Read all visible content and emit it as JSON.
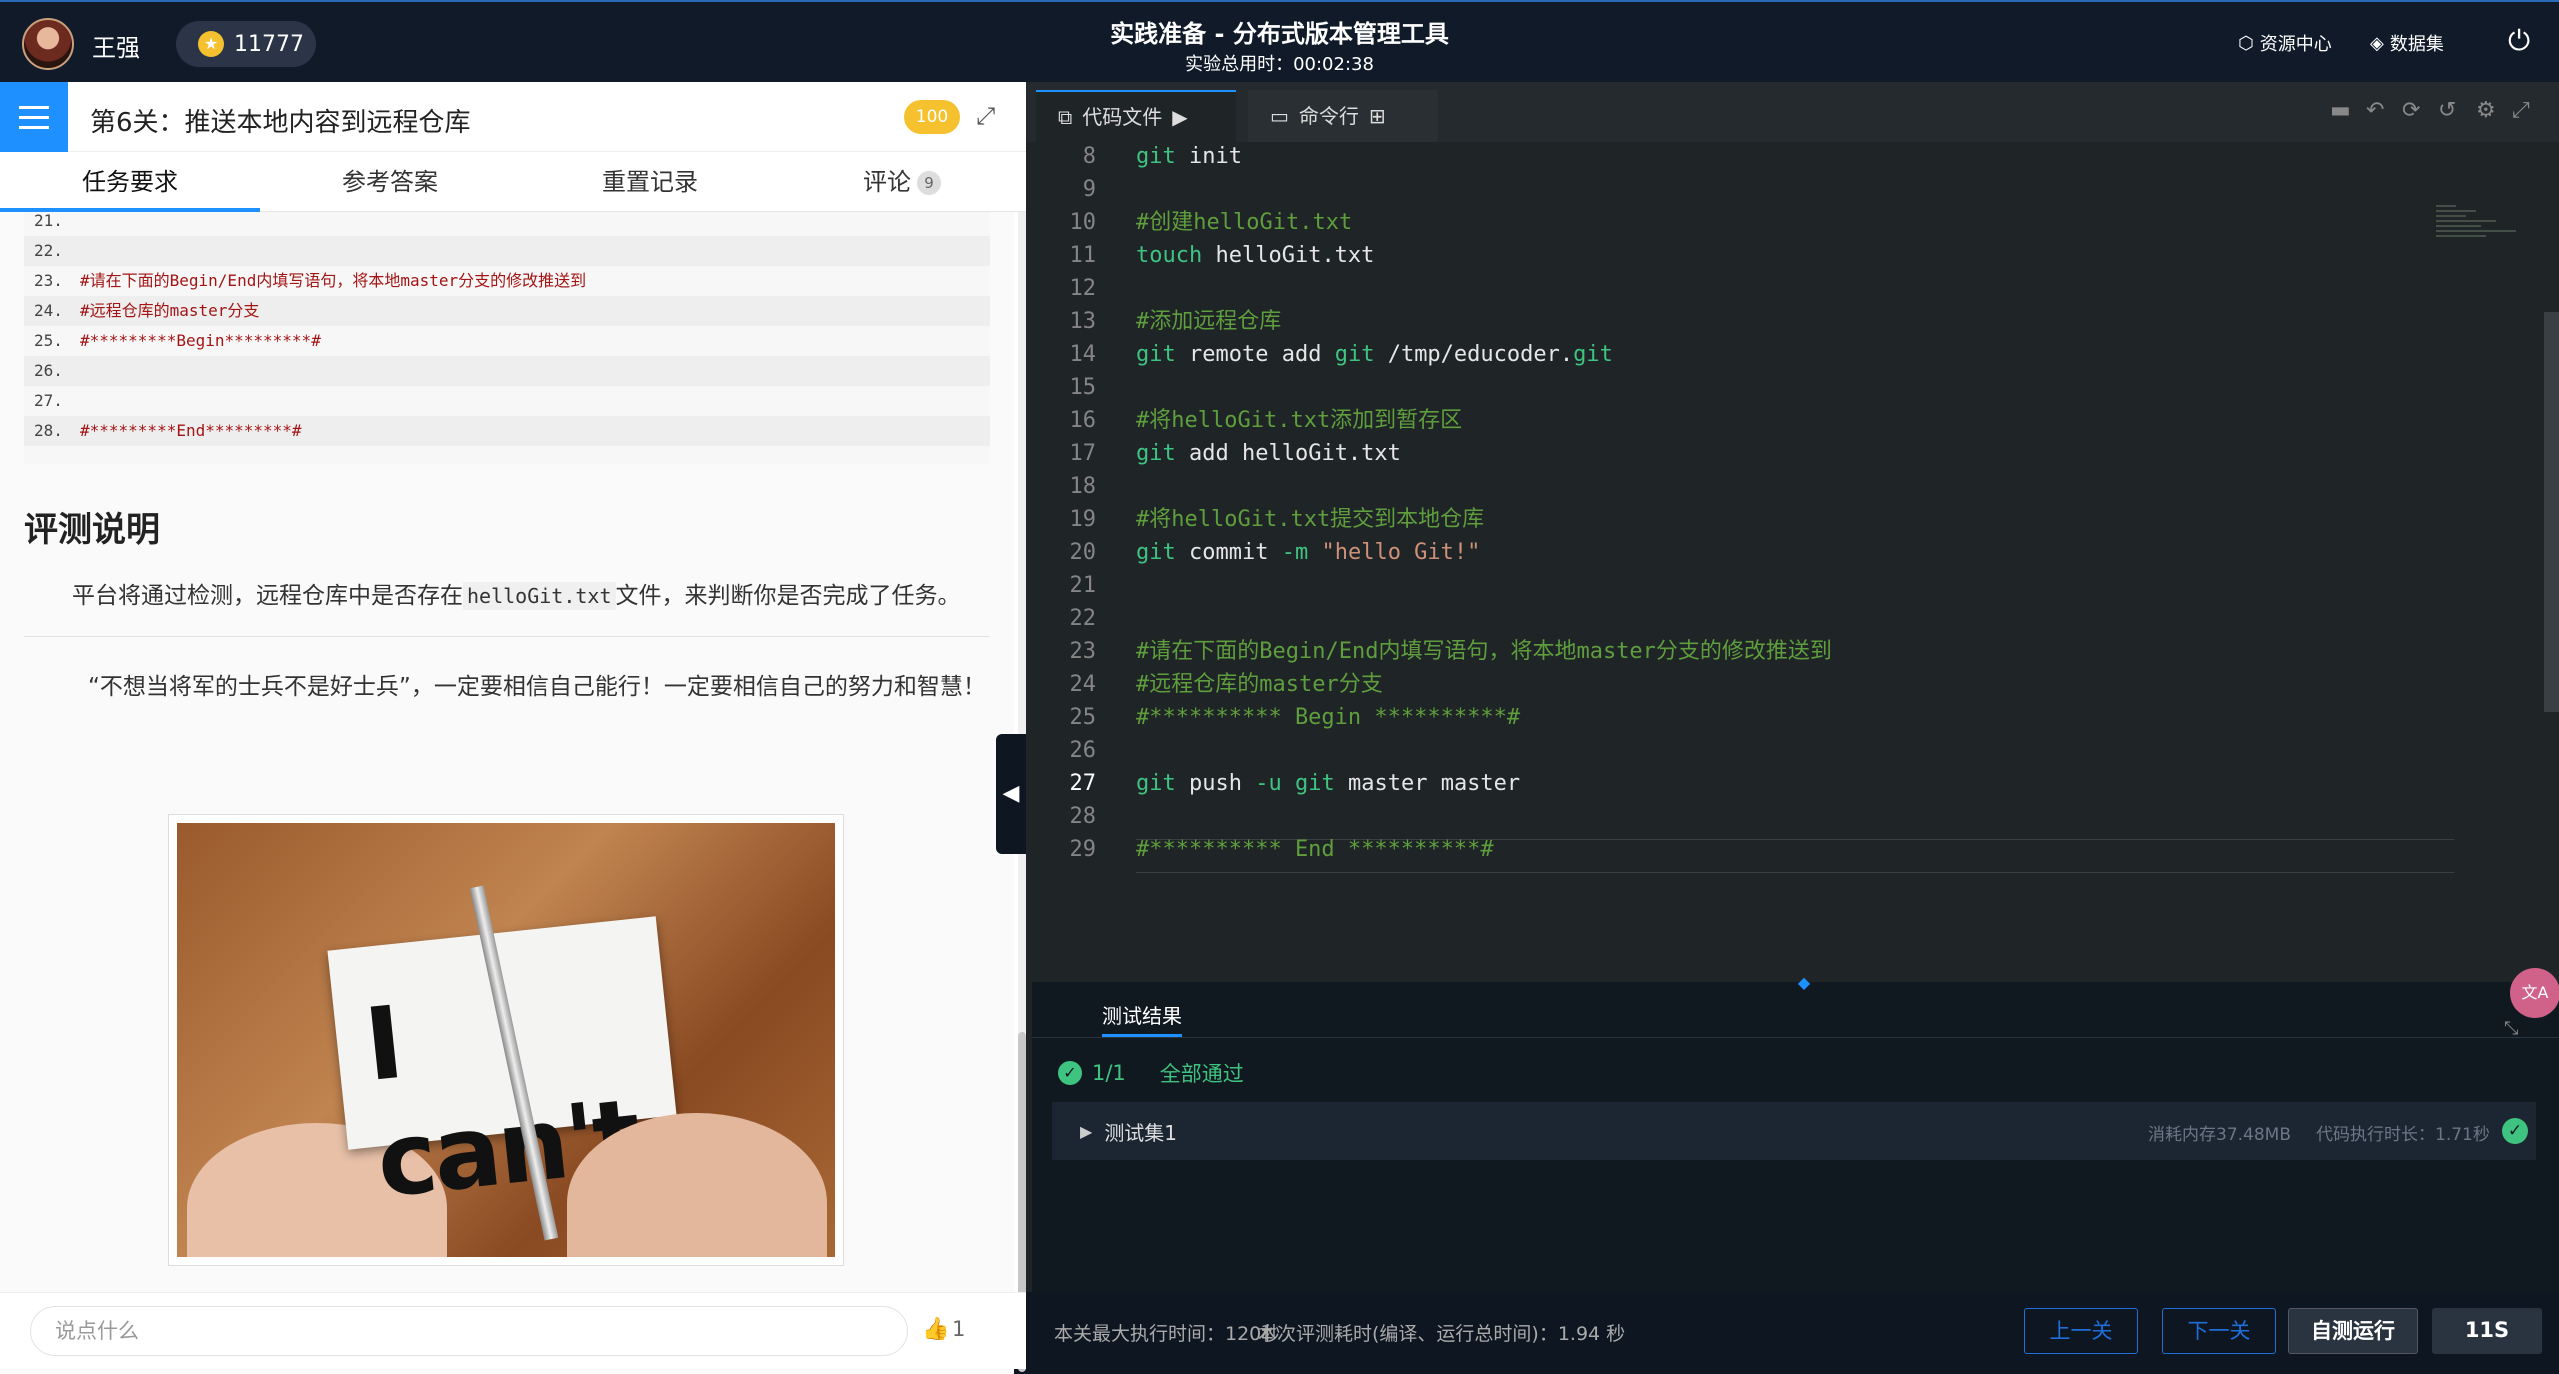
{
  "user": {
    "name": "王强",
    "coins": "11777"
  },
  "header": {
    "title": "实践准备 - 分布式版本管理工具",
    "timer": "实验总用时：00:02:38",
    "resource_center": "资源中心",
    "dataset": "数据集"
  },
  "stage": {
    "title": "第6关：推送本地内容到远程仓库",
    "score": "100"
  },
  "tabs": [
    {
      "label": "任务要求"
    },
    {
      "label": "参考答案"
    },
    {
      "label": "重置记录"
    },
    {
      "label": "评论"
    }
  ],
  "comment_count": "9",
  "doc": {
    "code_lines": [
      {
        "n": "21.",
        "t": ""
      },
      {
        "n": "22.",
        "t": ""
      },
      {
        "n": "23.",
        "t": "#请在下面的Begin/End内填写语句，将本地master分支的修改推送到"
      },
      {
        "n": "24.",
        "t": "#远程仓库的master分支"
      },
      {
        "n": "25.",
        "t": "#*********Begin*********#"
      },
      {
        "n": "26.",
        "t": ""
      },
      {
        "n": "27.",
        "t": ""
      },
      {
        "n": "28.",
        "t": "#*********End*********#"
      }
    ],
    "eval_heading": "评测说明",
    "eval_desc_pre": "平台将通过检测，远程仓库中是否存在",
    "eval_desc_code": "helloGit.txt",
    "eval_desc_post": "文件，来判断你是否完成了任务。",
    "quote": "“不想当将军的士兵不是好士兵”，一定要相信自己能行！一定要相信自己的努力和智慧！",
    "image_text": "I can't"
  },
  "comment": {
    "placeholder": "说点什么",
    "likes": "1"
  },
  "editor": {
    "tab_code": "代码文件",
    "tab_cmd": "命令行",
    "lines": [
      {
        "n": "8",
        "segs": [
          [
            "kw",
            "git"
          ],
          [
            "tx",
            " init"
          ]
        ]
      },
      {
        "n": "9",
        "segs": []
      },
      {
        "n": "10",
        "segs": [
          [
            "cm",
            "#创建helloGit.txt"
          ]
        ]
      },
      {
        "n": "11",
        "segs": [
          [
            "kw",
            "touch"
          ],
          [
            "tx",
            " helloGit.txt"
          ]
        ]
      },
      {
        "n": "12",
        "segs": []
      },
      {
        "n": "13",
        "segs": [
          [
            "cm",
            "#添加远程仓库"
          ]
        ]
      },
      {
        "n": "14",
        "segs": [
          [
            "kw",
            "git"
          ],
          [
            "tx",
            " remote add "
          ],
          [
            "kw",
            "git"
          ],
          [
            "tx",
            " /tmp/educoder."
          ],
          [
            "kw",
            "git"
          ]
        ]
      },
      {
        "n": "15",
        "segs": []
      },
      {
        "n": "16",
        "segs": [
          [
            "cm",
            "#将helloGit.txt添加到暂存区"
          ]
        ]
      },
      {
        "n": "17",
        "segs": [
          [
            "kw",
            "git"
          ],
          [
            "tx",
            " add helloGit.txt"
          ]
        ]
      },
      {
        "n": "18",
        "segs": []
      },
      {
        "n": "19",
        "segs": [
          [
            "cm",
            "#将helloGit.txt提交到本地仓库"
          ]
        ]
      },
      {
        "n": "20",
        "segs": [
          [
            "kw",
            "git"
          ],
          [
            "tx",
            " commit "
          ],
          [
            "kw",
            "-m"
          ],
          [
            "tx",
            " "
          ],
          [
            "st",
            "\"hello Git!\""
          ]
        ]
      },
      {
        "n": "21",
        "segs": []
      },
      {
        "n": "22",
        "segs": []
      },
      {
        "n": "23",
        "segs": [
          [
            "cm",
            "#请在下面的Begin/End内填写语句，将本地master分支的修改推送到"
          ]
        ]
      },
      {
        "n": "24",
        "segs": [
          [
            "cm",
            "#远程仓库的master分支"
          ]
        ]
      },
      {
        "n": "25",
        "segs": [
          [
            "cm",
            "#********** Begin **********#"
          ]
        ]
      },
      {
        "n": "26",
        "segs": []
      },
      {
        "n": "27",
        "segs": [
          [
            "kw",
            "git"
          ],
          [
            "tx",
            " push "
          ],
          [
            "kw",
            "-u"
          ],
          [
            "tx",
            " "
          ],
          [
            "kw",
            "git"
          ],
          [
            "tx",
            " master master"
          ]
        ]
      },
      {
        "n": "28",
        "segs": []
      },
      {
        "n": "29",
        "segs": [
          [
            "cm",
            "#********** End **********#"
          ]
        ]
      }
    ]
  },
  "results": {
    "tab": "测试结果",
    "pass_count": "1/1",
    "pass_label": "全部通过",
    "test_set": "测试集1",
    "memory": "消耗内存37.48MB",
    "duration": "代码执行时长：1.71秒"
  },
  "footer": {
    "max_time": "本关最大执行时间：120秒",
    "this_time": "本次评测耗时(编译、运行总时间)：1.94 秒",
    "prev": "上一关",
    "next": "下一关",
    "run": "自测运行",
    "time": "11S"
  },
  "colors": {
    "accent": "#1e90ff",
    "pass": "#3fc380",
    "coin": "#f5c12e"
  }
}
